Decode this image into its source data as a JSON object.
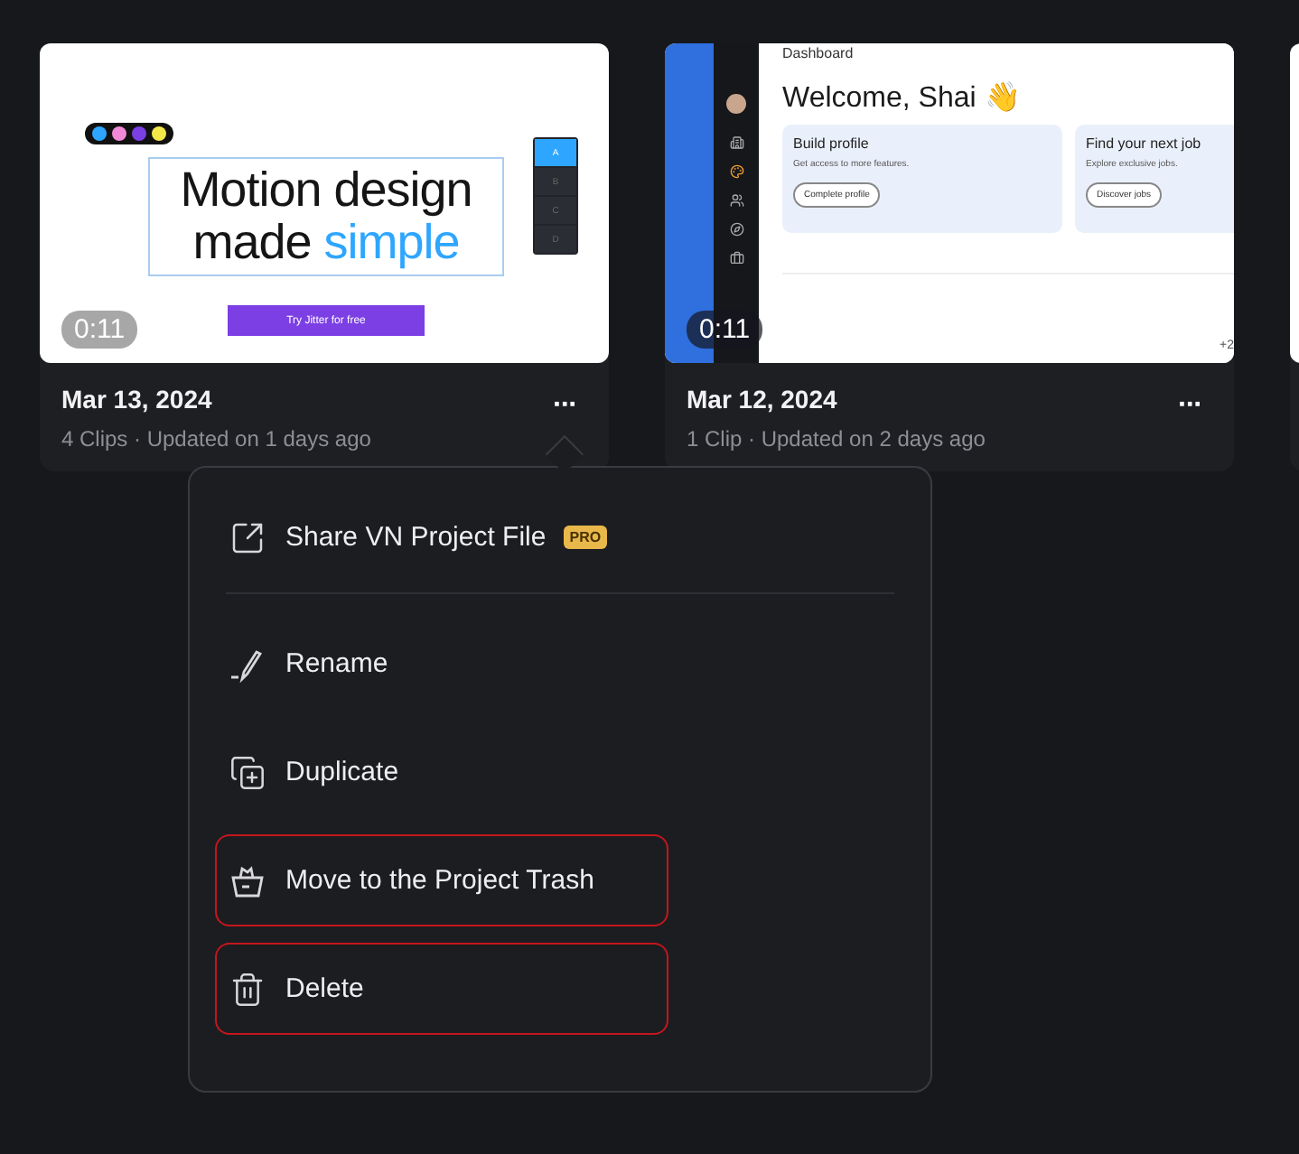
{
  "projects": [
    {
      "kind": "jitter",
      "duration": "0:11",
      "date": "Mar 13, 2024",
      "meta": "4 Clips · Updated on 1 days ago",
      "more": "···",
      "menu_open": true,
      "thumbnail": {
        "swatches": [
          {
            "color": "#2ea6ff"
          },
          {
            "color": "#f08ad8"
          },
          {
            "color": "#7b3fe4"
          },
          {
            "color": "#f5e94a"
          }
        ],
        "headline_1": "Motion design",
        "headline_2": "made",
        "headline_accent": "simple",
        "cta": "Try Jitter for free",
        "panel_keys": [
          {
            "label": "A",
            "selected": true
          },
          {
            "label": "B",
            "selected": false
          },
          {
            "label": "C",
            "selected": false
          },
          {
            "label": "D",
            "selected": false
          }
        ]
      }
    },
    {
      "kind": "dashboard",
      "duration": "0:11",
      "date": "Mar 12, 2024",
      "meta": "1 Clip · Updated on 2 days ago",
      "more": "···",
      "menu_open": false,
      "thumbnail": {
        "heading": "Dashboard",
        "welcome": "Welcome, Shai 👋",
        "cards": [
          {
            "title": "Build profile",
            "text": "Get access to more features.",
            "action": "Complete profile"
          },
          {
            "title": "Find your next job",
            "text": "Explore exclusive jobs.",
            "action": "Discover jobs"
          }
        ],
        "count": "+2"
      }
    },
    {
      "kind": "partial"
    }
  ],
  "menu": {
    "groups": [
      [
        {
          "kind": "share",
          "label": "Share VN Project File",
          "badge": "PRO",
          "highlighted": false
        }
      ],
      [
        {
          "kind": "rename",
          "label": "Rename",
          "highlighted": false
        },
        {
          "kind": "duplicate",
          "label": "Duplicate",
          "highlighted": false
        },
        {
          "kind": "trash",
          "label": "Move to the Project Trash",
          "highlighted": true
        },
        {
          "kind": "delete",
          "label": "Delete",
          "highlighted": true
        }
      ]
    ]
  }
}
